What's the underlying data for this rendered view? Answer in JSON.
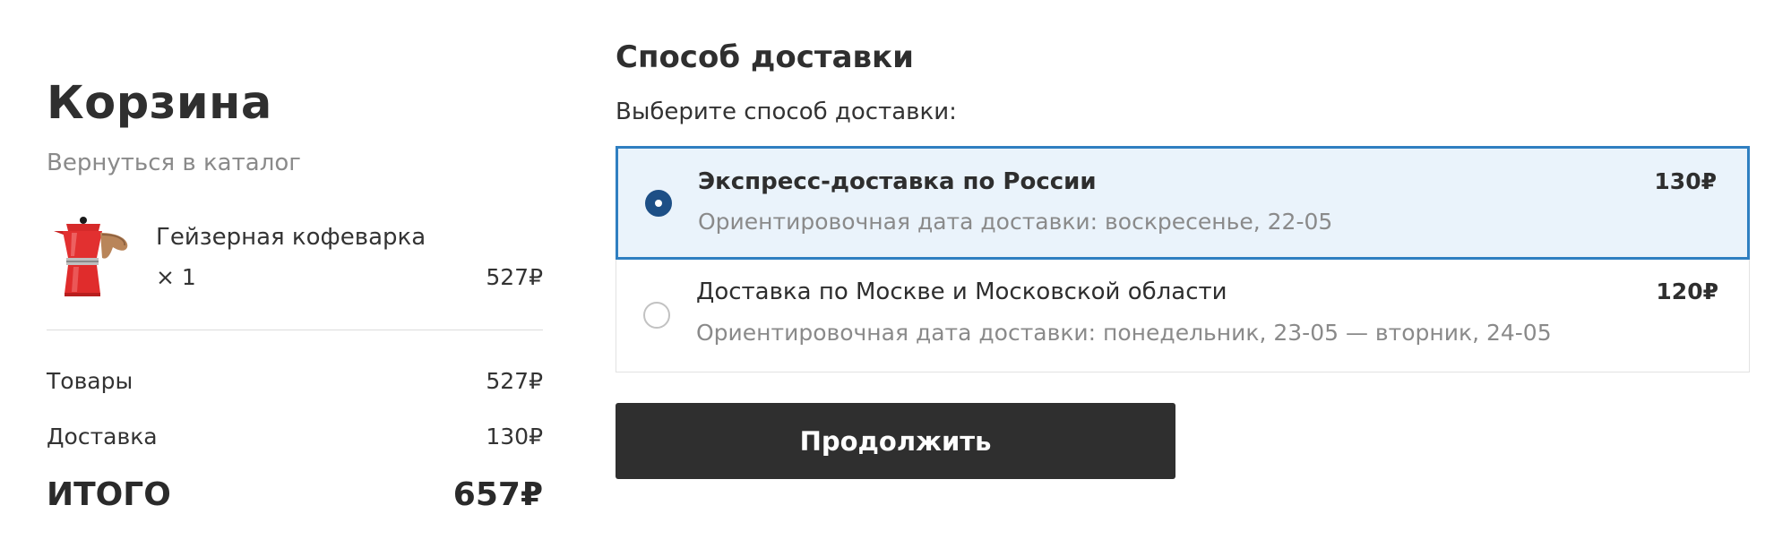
{
  "cart": {
    "title": "Корзина",
    "back_link": "Вернуться в каталог",
    "item": {
      "image": "moka-pot-red",
      "name": "Гейзерная кофеварка",
      "quantity": "× 1",
      "price": "527₽"
    },
    "summary": {
      "goods_label": "Товары",
      "goods_value": "527₽",
      "delivery_label": "Доставка",
      "delivery_value": "130₽",
      "total_label": "ИТОГО",
      "total_value": "657₽"
    }
  },
  "delivery": {
    "title": "Способ доставки",
    "subtitle": "Выберите способ доставки:",
    "options": [
      {
        "title": "Экспресс-доставка по России",
        "date": "Ориентировочная дата доставки: воскресенье, 22-05",
        "price": "130₽",
        "selected": true
      },
      {
        "title": "Доставка по Москве и Московской области",
        "date": "Ориентировочная дата доставки: понедельник, 23-05 — вторник, 24-05",
        "price": "120₽",
        "selected": false
      }
    ],
    "continue_label": "Продолжить"
  },
  "colors": {
    "selected_border": "#2f7fc1",
    "selected_background": "#eaf3fb",
    "radio_selected": "#1d4f86",
    "button_background": "#2f2f2f"
  }
}
